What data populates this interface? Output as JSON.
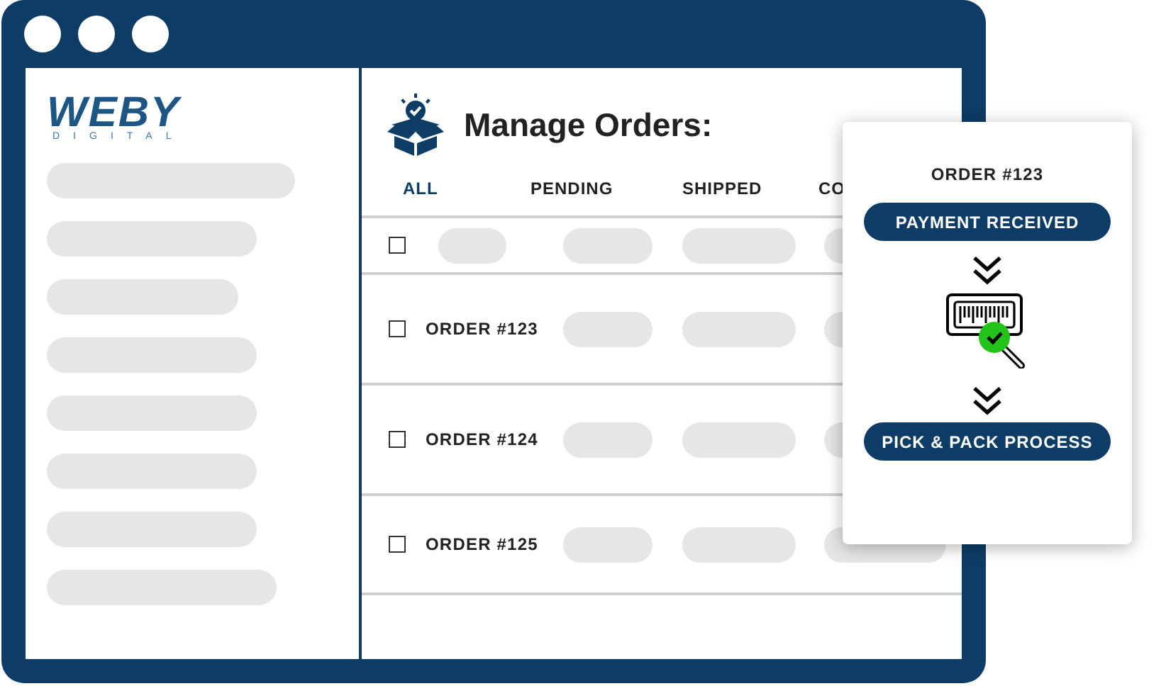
{
  "logo": {
    "name": "WEBY",
    "tagline": "DIGITAL"
  },
  "header": {
    "title": "Manage Orders:"
  },
  "tabs": [
    {
      "label": "ALL",
      "selected": true
    },
    {
      "label": "PENDING",
      "selected": false
    },
    {
      "label": "SHIPPED",
      "selected": false
    },
    {
      "label": "CO",
      "selected": false
    }
  ],
  "rows": [
    {
      "kind": "placeholder",
      "checked": false
    },
    {
      "kind": "order",
      "label": "ORDER #123",
      "checked": false
    },
    {
      "kind": "order",
      "label": "ORDER #124",
      "checked": false
    },
    {
      "kind": "order",
      "label": "ORDER #125",
      "checked": false
    }
  ],
  "popup": {
    "order": "ORDER #123",
    "steps": [
      "PAYMENT RECEIVED",
      "PICK & PACK PROCESS"
    ]
  }
}
